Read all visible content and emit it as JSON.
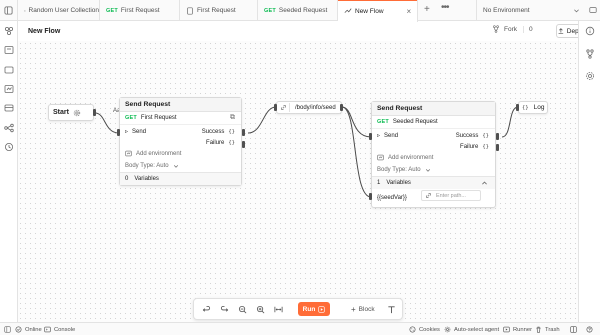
{
  "tabs": [
    {
      "label": "Random User Collection",
      "method": ""
    },
    {
      "label": "First Request",
      "method": "GET"
    },
    {
      "label": "First Request",
      "method": ""
    },
    {
      "label": "Seeded Request",
      "method": "GET"
    },
    {
      "label": "New Flow",
      "method": ""
    }
  ],
  "environment": {
    "selected": "No Environment"
  },
  "header": {
    "title": "New Flow",
    "fork_label": "Fork",
    "fork_count": "0",
    "deploy_label": "Deploy"
  },
  "canvas": {
    "start": {
      "label": "Start",
      "aa": "Aa"
    },
    "request1": {
      "title": "Send Request",
      "method": "GET",
      "request_name": "First Request",
      "send_label": "Send",
      "success_label": "Success",
      "failure_label": "Failure",
      "add_env_label": "Add environment",
      "body_type_label": "Body Type: Auto",
      "vars_count": "0",
      "vars_label": "Variables"
    },
    "select": {
      "path": "/body/info/seed"
    },
    "request2": {
      "title": "Send Request",
      "method": "GET",
      "request_name": "Seeded Request",
      "send_label": "Send",
      "success_label": "Success",
      "failure_label": "Failure",
      "add_env_label": "Add environment",
      "body_type_label": "Body Type: Auto",
      "vars_count": "1",
      "vars_label": "Variables",
      "var_name": "{{seedVar}}",
      "var_placeholder": "Enter path..."
    },
    "log": {
      "label": "Log"
    },
    "port_glyph": "{}"
  },
  "toolbar": {
    "run_label": "Run",
    "block_label": "Block"
  },
  "statusbar": {
    "online": "Online",
    "console": "Console",
    "cookies": "Cookies",
    "agent": "Auto-select agent",
    "runner": "Runner",
    "trash": "Trash"
  },
  "colors": {
    "accent": "#ff6c37",
    "get_method": "#0cbb52"
  }
}
